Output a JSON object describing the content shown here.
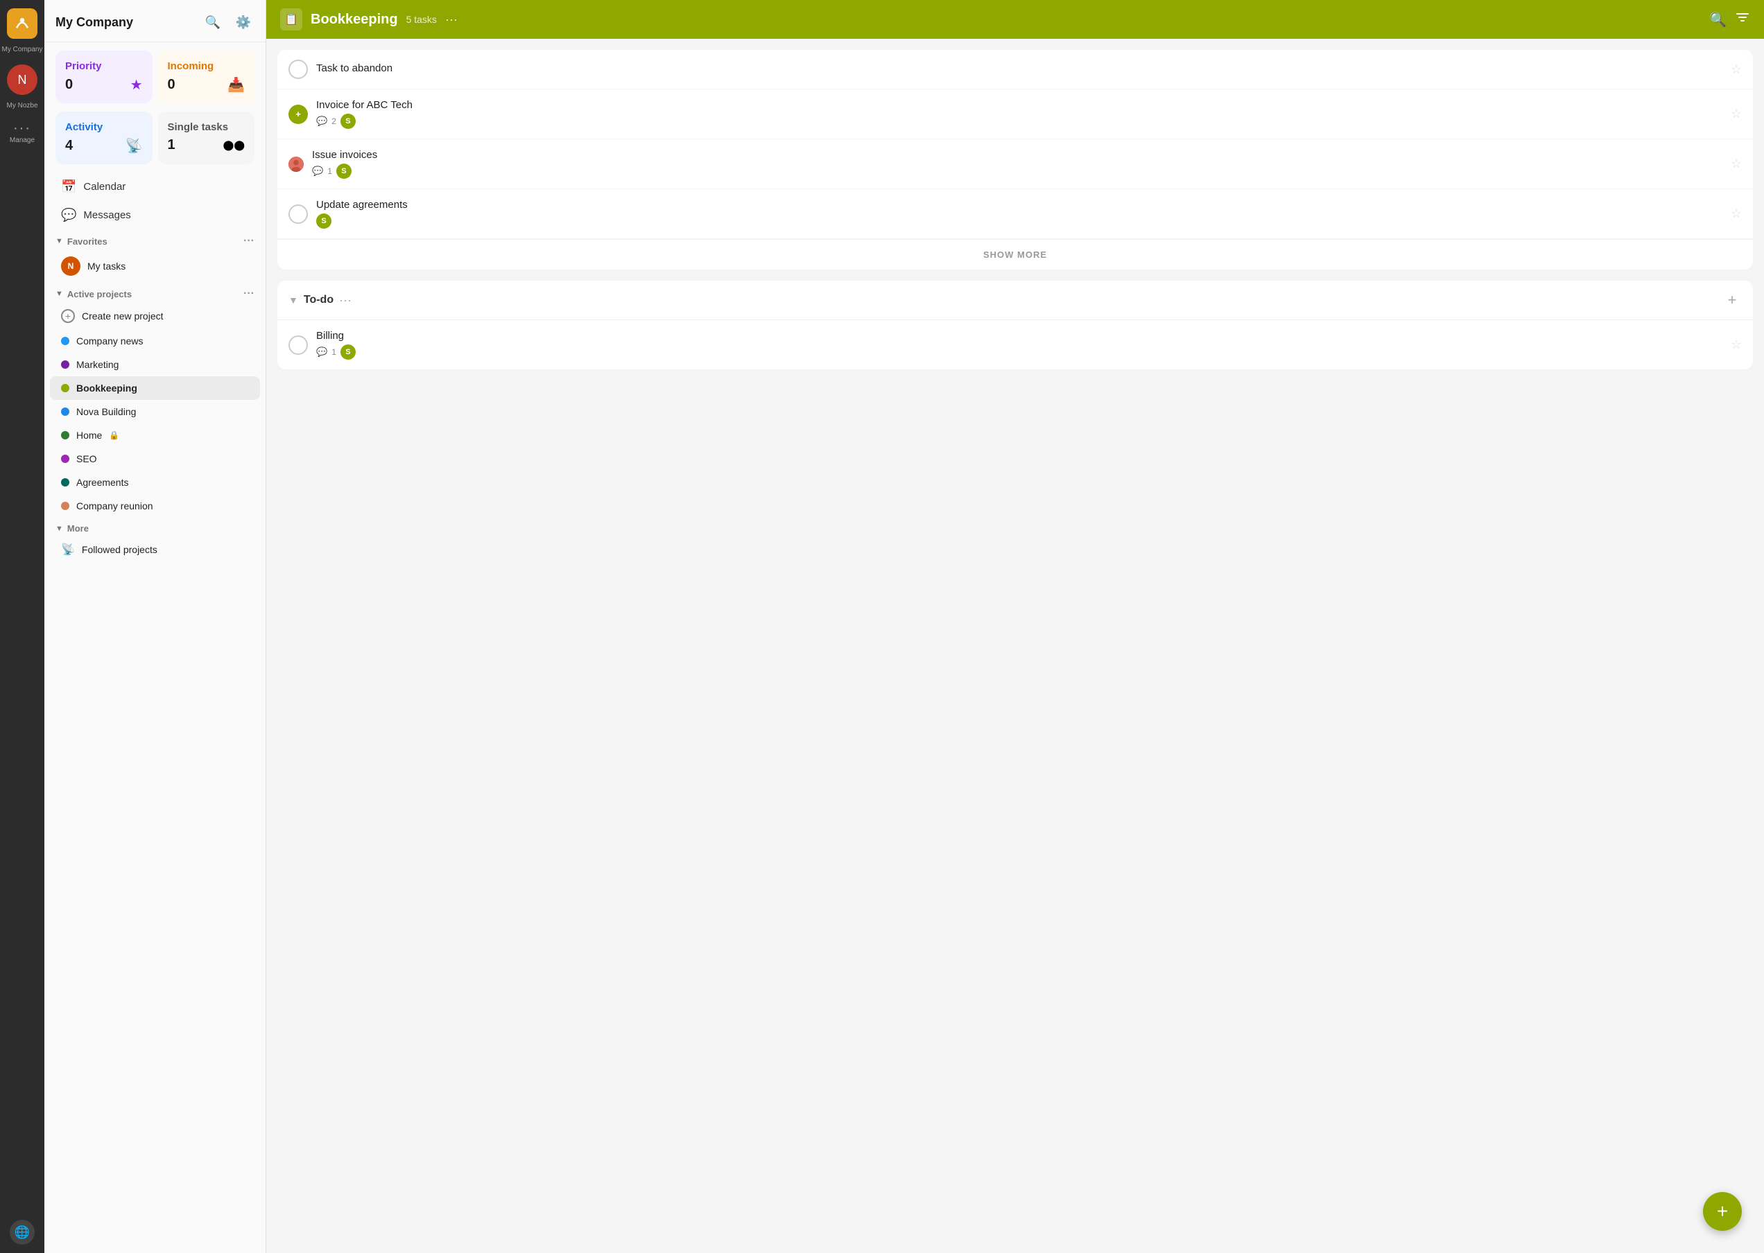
{
  "app": {
    "company_name": "My Company",
    "user_initial": "N"
  },
  "sidebar": {
    "title": "My Company",
    "search_label": "Search",
    "settings_label": "Settings",
    "cards": [
      {
        "id": "priority",
        "label": "Priority",
        "count": "0",
        "icon": "★",
        "color_class": "card-label-purple",
        "bg_class": "card-priority"
      },
      {
        "id": "incoming",
        "label": "Incoming",
        "count": "0",
        "icon": "📥",
        "color_class": "card-label-orange",
        "bg_class": "card-incoming"
      },
      {
        "id": "activity",
        "label": "Activity",
        "count": "4",
        "icon": "📡",
        "color_class": "card-label-blue",
        "bg_class": "card-activity"
      },
      {
        "id": "single",
        "label": "Single tasks",
        "count": "1",
        "icon": "⬤⬤",
        "color_class": "card-label-gray",
        "bg_class": "card-single"
      }
    ],
    "nav_items": [
      {
        "id": "calendar",
        "label": "Calendar",
        "icon": "📅"
      },
      {
        "id": "messages",
        "label": "Messages",
        "icon": "💬"
      }
    ],
    "favorites_label": "Favorites",
    "my_tasks_label": "My tasks",
    "active_projects_label": "Active projects",
    "projects": [
      {
        "id": "create-new",
        "label": "Create new project",
        "dot_color": null,
        "is_add": true
      },
      {
        "id": "company-news",
        "label": "Company news",
        "dot_color": "#2196F3",
        "is_add": false
      },
      {
        "id": "marketing",
        "label": "Marketing",
        "dot_color": "#7b1fa2",
        "is_add": false
      },
      {
        "id": "bookkeeping",
        "label": "Bookkeeping",
        "dot_color": "#8fa800",
        "is_add": false,
        "active": true
      },
      {
        "id": "nova-building",
        "label": "Nova Building",
        "dot_color": "#1e88e5",
        "is_add": false
      },
      {
        "id": "home",
        "label": "Home",
        "dot_color": "#2e7d32",
        "is_add": false,
        "has_lock": true
      },
      {
        "id": "seo",
        "label": "SEO",
        "dot_color": "#9c27b0",
        "is_add": false
      },
      {
        "id": "agreements",
        "label": "Agreements",
        "dot_color": "#00695c",
        "is_add": false
      },
      {
        "id": "company-reunion",
        "label": "Company reunion",
        "dot_color": "#d4825a",
        "is_add": false
      }
    ],
    "more_label": "More",
    "followed_projects_label": "Followed projects"
  },
  "topbar": {
    "project_icon": "📋",
    "project_title": "Bookkeeping",
    "task_count": "5 tasks",
    "options_label": "···"
  },
  "task_sections": [
    {
      "id": "inbox",
      "title": null,
      "show_more": true,
      "show_more_label": "SHOW MORE",
      "tasks": [
        {
          "id": "task1",
          "title": "Task to abandon",
          "comments": null,
          "has_avatar": false,
          "has_s_badge": false
        },
        {
          "id": "task2",
          "title": "Invoice for ABC Tech",
          "comments": "2",
          "has_avatar": false,
          "has_s_badge": true
        },
        {
          "id": "task3",
          "title": "Issue invoices",
          "comments": "1",
          "has_avatar": true,
          "has_s_badge": true
        },
        {
          "id": "task4",
          "title": "Update agreements",
          "comments": null,
          "has_avatar": false,
          "has_s_badge": true
        }
      ]
    },
    {
      "id": "todo",
      "title": "To-do",
      "show_more": false,
      "tasks": [
        {
          "id": "task5",
          "title": "Billing",
          "comments": "1",
          "has_avatar": false,
          "has_s_badge": true
        }
      ]
    }
  ]
}
